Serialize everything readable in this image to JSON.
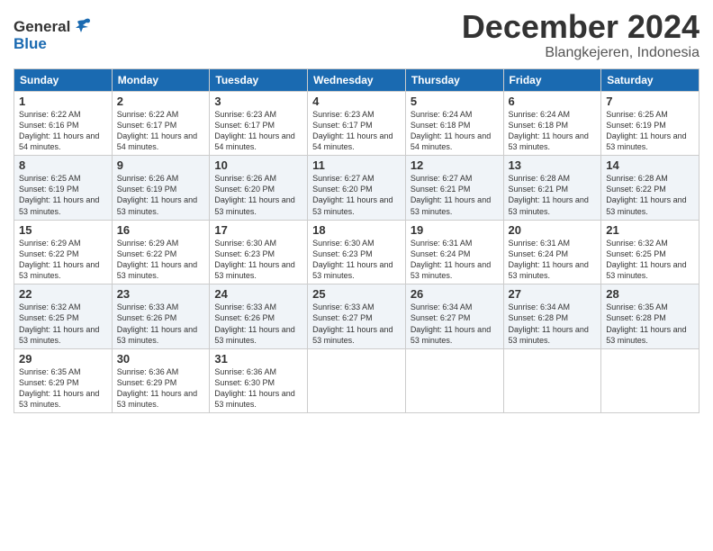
{
  "header": {
    "logo": {
      "general": "General",
      "blue": "Blue"
    },
    "title": "December 2024",
    "subtitle": "Blangkejeren, Indonesia"
  },
  "weekdays": [
    "Sunday",
    "Monday",
    "Tuesday",
    "Wednesday",
    "Thursday",
    "Friday",
    "Saturday"
  ],
  "weeks": [
    [
      {
        "day": 1,
        "sunrise": "6:22 AM",
        "sunset": "6:16 PM",
        "daylight": "11 hours and 54 minutes"
      },
      {
        "day": 2,
        "sunrise": "6:22 AM",
        "sunset": "6:17 PM",
        "daylight": "11 hours and 54 minutes"
      },
      {
        "day": 3,
        "sunrise": "6:23 AM",
        "sunset": "6:17 PM",
        "daylight": "11 hours and 54 minutes"
      },
      {
        "day": 4,
        "sunrise": "6:23 AM",
        "sunset": "6:17 PM",
        "daylight": "11 hours and 54 minutes"
      },
      {
        "day": 5,
        "sunrise": "6:24 AM",
        "sunset": "6:18 PM",
        "daylight": "11 hours and 54 minutes"
      },
      {
        "day": 6,
        "sunrise": "6:24 AM",
        "sunset": "6:18 PM",
        "daylight": "11 hours and 53 minutes"
      },
      {
        "day": 7,
        "sunrise": "6:25 AM",
        "sunset": "6:19 PM",
        "daylight": "11 hours and 53 minutes"
      }
    ],
    [
      {
        "day": 8,
        "sunrise": "6:25 AM",
        "sunset": "6:19 PM",
        "daylight": "11 hours and 53 minutes"
      },
      {
        "day": 9,
        "sunrise": "6:26 AM",
        "sunset": "6:19 PM",
        "daylight": "11 hours and 53 minutes"
      },
      {
        "day": 10,
        "sunrise": "6:26 AM",
        "sunset": "6:20 PM",
        "daylight": "11 hours and 53 minutes"
      },
      {
        "day": 11,
        "sunrise": "6:27 AM",
        "sunset": "6:20 PM",
        "daylight": "11 hours and 53 minutes"
      },
      {
        "day": 12,
        "sunrise": "6:27 AM",
        "sunset": "6:21 PM",
        "daylight": "11 hours and 53 minutes"
      },
      {
        "day": 13,
        "sunrise": "6:28 AM",
        "sunset": "6:21 PM",
        "daylight": "11 hours and 53 minutes"
      },
      {
        "day": 14,
        "sunrise": "6:28 AM",
        "sunset": "6:22 PM",
        "daylight": "11 hours and 53 minutes"
      }
    ],
    [
      {
        "day": 15,
        "sunrise": "6:29 AM",
        "sunset": "6:22 PM",
        "daylight": "11 hours and 53 minutes"
      },
      {
        "day": 16,
        "sunrise": "6:29 AM",
        "sunset": "6:22 PM",
        "daylight": "11 hours and 53 minutes"
      },
      {
        "day": 17,
        "sunrise": "6:30 AM",
        "sunset": "6:23 PM",
        "daylight": "11 hours and 53 minutes"
      },
      {
        "day": 18,
        "sunrise": "6:30 AM",
        "sunset": "6:23 PM",
        "daylight": "11 hours and 53 minutes"
      },
      {
        "day": 19,
        "sunrise": "6:31 AM",
        "sunset": "6:24 PM",
        "daylight": "11 hours and 53 minutes"
      },
      {
        "day": 20,
        "sunrise": "6:31 AM",
        "sunset": "6:24 PM",
        "daylight": "11 hours and 53 minutes"
      },
      {
        "day": 21,
        "sunrise": "6:32 AM",
        "sunset": "6:25 PM",
        "daylight": "11 hours and 53 minutes"
      }
    ],
    [
      {
        "day": 22,
        "sunrise": "6:32 AM",
        "sunset": "6:25 PM",
        "daylight": "11 hours and 53 minutes"
      },
      {
        "day": 23,
        "sunrise": "6:33 AM",
        "sunset": "6:26 PM",
        "daylight": "11 hours and 53 minutes"
      },
      {
        "day": 24,
        "sunrise": "6:33 AM",
        "sunset": "6:26 PM",
        "daylight": "11 hours and 53 minutes"
      },
      {
        "day": 25,
        "sunrise": "6:33 AM",
        "sunset": "6:27 PM",
        "daylight": "11 hours and 53 minutes"
      },
      {
        "day": 26,
        "sunrise": "6:34 AM",
        "sunset": "6:27 PM",
        "daylight": "11 hours and 53 minutes"
      },
      {
        "day": 27,
        "sunrise": "6:34 AM",
        "sunset": "6:28 PM",
        "daylight": "11 hours and 53 minutes"
      },
      {
        "day": 28,
        "sunrise": "6:35 AM",
        "sunset": "6:28 PM",
        "daylight": "11 hours and 53 minutes"
      }
    ],
    [
      {
        "day": 29,
        "sunrise": "6:35 AM",
        "sunset": "6:29 PM",
        "daylight": "11 hours and 53 minutes"
      },
      {
        "day": 30,
        "sunrise": "6:36 AM",
        "sunset": "6:29 PM",
        "daylight": "11 hours and 53 minutes"
      },
      {
        "day": 31,
        "sunrise": "6:36 AM",
        "sunset": "6:30 PM",
        "daylight": "11 hours and 53 minutes"
      },
      null,
      null,
      null,
      null
    ]
  ]
}
